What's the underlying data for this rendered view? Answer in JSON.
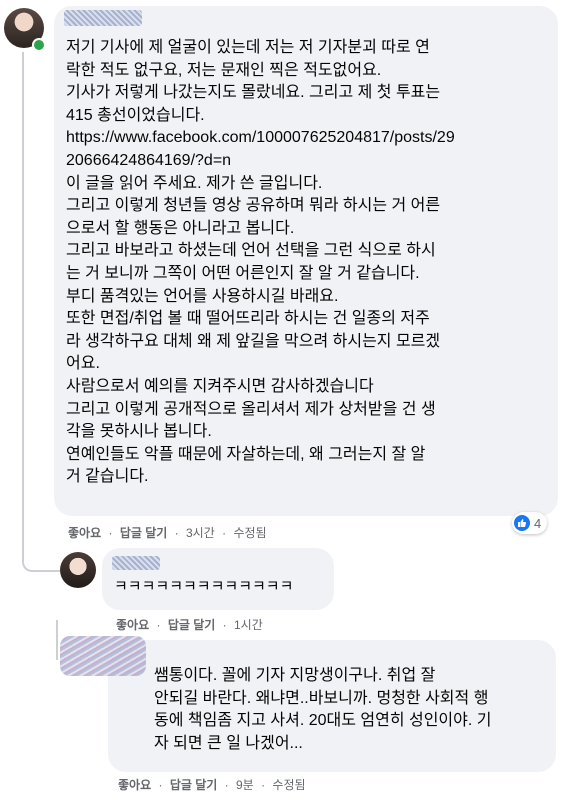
{
  "comments": [
    {
      "text": "저기 기사에 제 얼굴이 있는데 저는 저 기자분괴 따로 연\n락한 적도 없구요, 저는 문재인 찍은 적도없어요.\n기사가 저렇게 나갔는지도 몰랐네요. 그리고 제 첫 투표는\n415 총선이었습니다.\nhttps://www.facebook.com/100007625204817/posts/29\n20666424864169/?d=n\n이 글을 읽어 주세요. 제가 쓴 글입니다.\n그리고 이렇게 청년들 영상 공유하며 뭐라 하시는 거 어른\n으로서 할 행동은 아니라고 봅니다.\n그리고 바보라고 하셨는데 언어 선택을 그런 식으로 하시\n는 거 보니까 그쪽이 어떤 어른인지 잘 알 거 같습니다.\n부디 품격있는 언어를 사용하시길 바래요.\n또한 면접/취업 볼 때 떨어뜨리라 하시는 건 일종의 저주\n라 생각하구요 대체 왜 제 앞길을 막으려 하시는지 모르겠\n어요.\n사람으로서 예의를 지켜주시면 감사하겠습니다\n그리고 이렇게 공개적으로 올리셔서 제가 상처받을 건 생\n각을 못하시나 봅니다.\n연예인들도 악플 때문에 자살하는데, 왜 그러는지 잘 알\n거 같습니다.",
      "like": "좋아요",
      "reply": "답글 달기",
      "time": "3시간",
      "edited": "수정됨",
      "reaction_count": "4"
    },
    {
      "text": "ㅋㅋㅋㅋㅋㅋㅋㅋㅋㅋㅋㅋㅋ",
      "like": "좋아요",
      "reply": "답글 달기",
      "time": "1시간"
    },
    {
      "text": "쌤통이다. 꼴에 기자 지망생이구나. 취업 잘\n안되길 바란다. 왜냐면..바보니까. 멍청한 사회적 행\n동에 책임좀 지고 사셔. 20대도 엄연히 성인이야. 기\n자 되면 큰 일 나겠어...",
      "like": "좋아요",
      "reply": "답글 달기",
      "time": "9분",
      "edited": "수정됨"
    }
  ],
  "separator": "·",
  "colors": {
    "bubble": "#f0f2f5",
    "meta": "#65676b",
    "like_blue": "#1877f2",
    "online": "#31a24c"
  }
}
